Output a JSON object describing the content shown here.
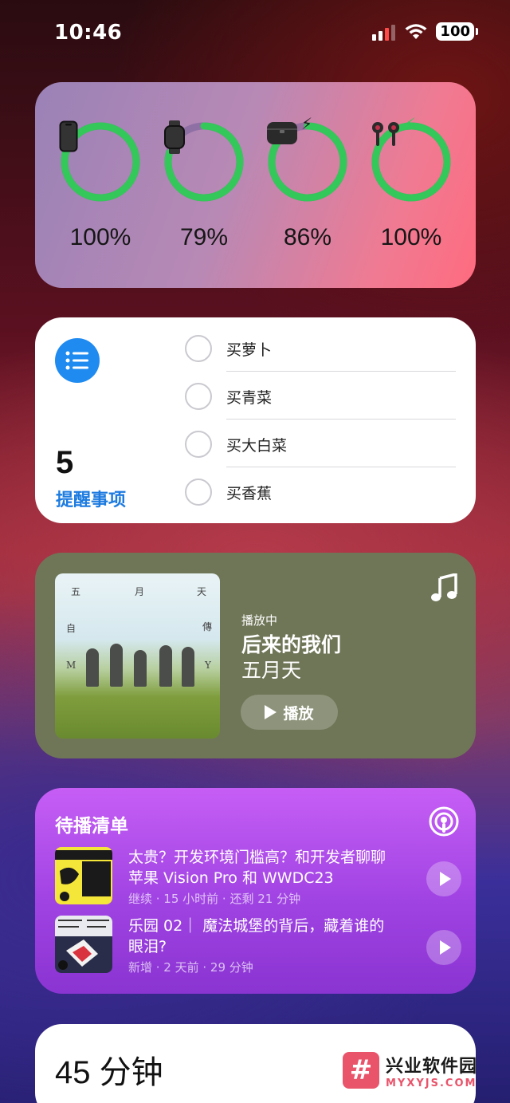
{
  "status_bar": {
    "time": "10:46",
    "battery": "100"
  },
  "batteries_widget": {
    "devices": [
      {
        "icon": "iphone-icon",
        "percent": "100%",
        "level": 1.0,
        "charging": false
      },
      {
        "icon": "apple-watch-icon",
        "percent": "79%",
        "level": 0.79,
        "charging": false
      },
      {
        "icon": "airpods-case-icon",
        "percent": "86%",
        "level": 0.86,
        "charging": true
      },
      {
        "icon": "airpods-icon",
        "percent": "100%",
        "level": 1.0,
        "charging": true
      }
    ],
    "ring_color": "#34c759"
  },
  "reminders_widget": {
    "count": "5",
    "title": "提醒事项",
    "items": [
      "买萝卜",
      "买青菜",
      "买大白菜",
      "买香蕉"
    ],
    "accent": "#1f8bf0"
  },
  "music_widget": {
    "status": "播放中",
    "song": "后来的我们",
    "artist": "五月天",
    "play_label": "播放",
    "album_letters": [
      "五",
      "月",
      "天",
      "自",
      "傳",
      "M",
      "Y"
    ]
  },
  "podcasts_widget": {
    "title": "待播清单",
    "episodes": [
      {
        "title": "太贵？开发环境门槛高？和开发者聊聊苹果 Vision Pro 和 WWDC23",
        "meta": "继续 · 15 小时前 · 还剩 21 分钟"
      },
      {
        "title": "乐园 02｜ 魔法城堡的背后，藏着谁的眼泪?",
        "meta": "新增 · 2 天前 · 29 分钟"
      }
    ]
  },
  "screen_time_widget": {
    "value": "45 分钟"
  },
  "watermark": {
    "logo": "#",
    "name": "兴业软件园",
    "url": "MYXYJS.COM"
  }
}
